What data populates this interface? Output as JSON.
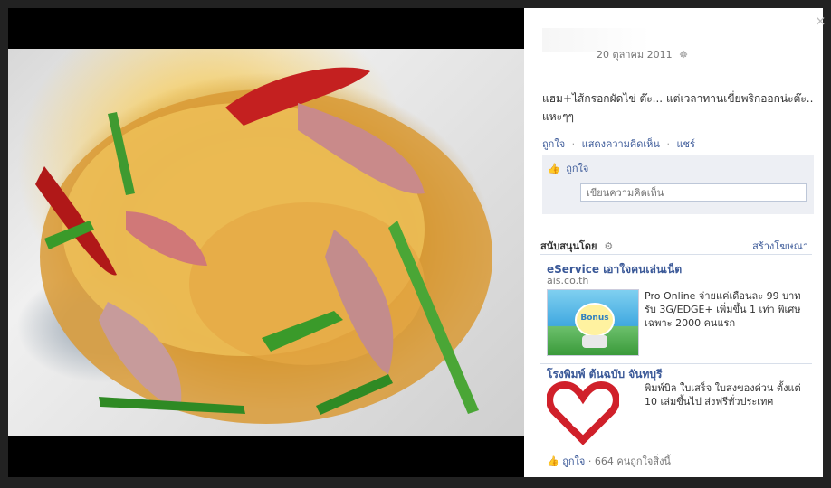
{
  "post": {
    "date": "20 ตุลาคม 2011",
    "caption": "แฮม+ไส้กรอกผัดไข่ ต๊ะ... แต่เวลาทานเขี่ยพริกออกน่ะต๊ะ.. แหะๆๆ",
    "actions": {
      "like": "ถูกใจ",
      "comment": "แสดงความคิดเห็น",
      "share": "แชร์",
      "separator": "·"
    },
    "like_label": "ถูกใจ",
    "comment_placeholder": "เขียนความคิดเห็น"
  },
  "sponsored": {
    "heading": "สนับสนุนโดย",
    "create_ad": "สร้างโฆษณา",
    "ads": [
      {
        "title": "eService เอาใจคนเล่นเน็ต",
        "url": "ais.co.th",
        "image_text": "Bonus",
        "body": "Pro Online จ่ายแค่เดือนละ 99 บาทรับ 3G/EDGE+ เพิ่มขึ้น 1 เท่า พิเศษเฉพาะ 2000 คนแรก"
      },
      {
        "title": "โรงพิมพ์ ต้นฉบับ จันทบุรี",
        "body": "พิมพ์บิล ใบเสร็จ ใบส่งของด่วน ตั้งแต่ 10 เล่มขึ้นไป ส่งฟรีทั่วประเทศ",
        "like": "ถูกใจ",
        "like_count": "664 คนถูกใจสิ่งนี้"
      }
    ]
  },
  "icons": {
    "close": "×",
    "globe": "☸",
    "gear": "⚙",
    "thumb": "👍"
  },
  "colors": {
    "link": "#3b5998",
    "panel_bg": "#ffffff",
    "stage_bg": "#000000"
  }
}
